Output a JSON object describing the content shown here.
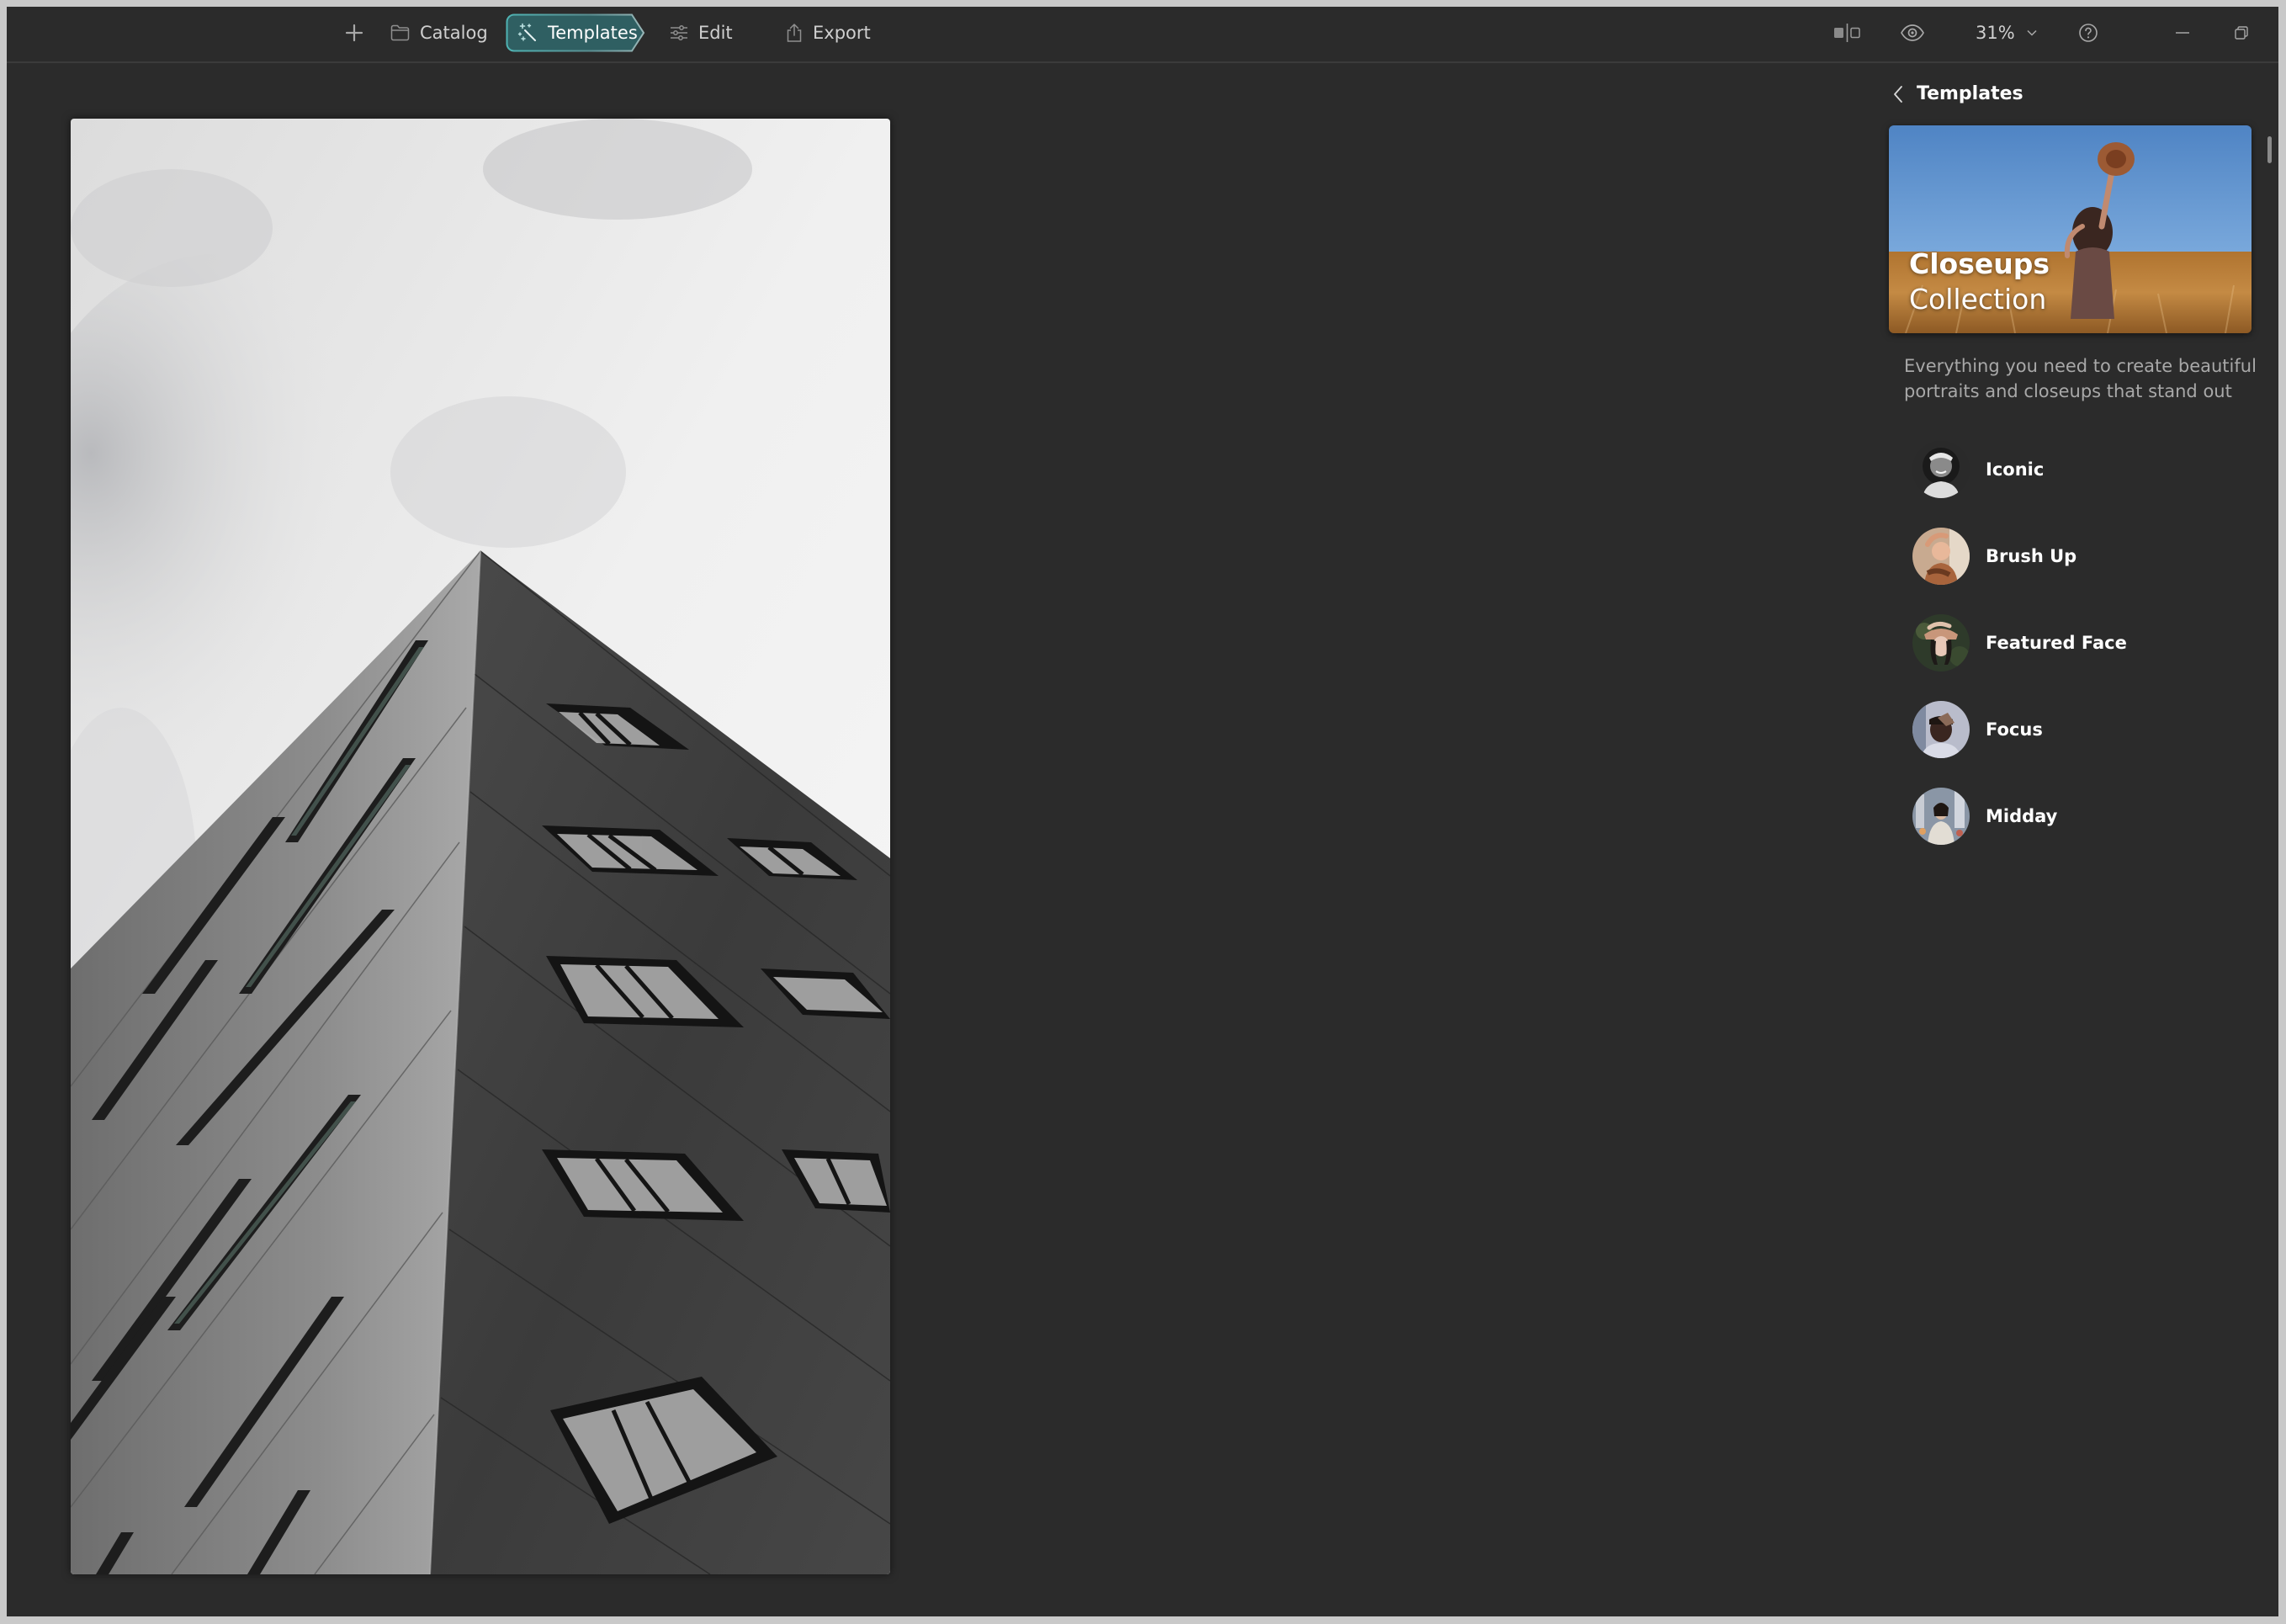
{
  "toolbar": {
    "add_icon": "plus-icon",
    "catalog_label": "Catalog",
    "catalog_icon": "folder-icon",
    "templates_label": "Templates",
    "templates_icon": "magic-wand-icon",
    "edit_label": "Edit",
    "edit_icon": "sliders-icon",
    "export_label": "Export",
    "export_icon": "share-icon",
    "active_tab": "Templates",
    "accent_color": "#2f6063",
    "right": {
      "compare_icon": "compare-icon",
      "preview_icon": "eye-icon",
      "zoom_level": "31%",
      "zoom_dropdown_icon": "chevron-down-icon",
      "help_icon": "help-icon",
      "minimize_icon": "minimize-icon",
      "restore_icon": "restore-icon"
    }
  },
  "canvas": {
    "photo_subject": "Black-and-white low-angle photo of an angular building against cloudy sky"
  },
  "panel": {
    "back_icon": "chevron-left-icon",
    "title": "Templates",
    "collection": {
      "title_line1": "Closeups",
      "title_line2": "Collection",
      "image_subject": "Woman in wheat field raising hat against blue sky"
    },
    "description": "Everything you need to create beautiful portraits and closeups that stand out",
    "templates": [
      {
        "name": "Iconic"
      },
      {
        "name": "Brush Up"
      },
      {
        "name": "Featured Face"
      },
      {
        "name": "Focus"
      },
      {
        "name": "Midday"
      }
    ]
  }
}
